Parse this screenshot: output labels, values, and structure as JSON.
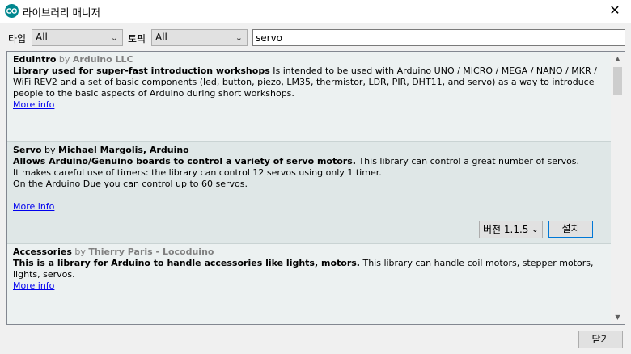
{
  "window": {
    "title": "라이브러리 매니저",
    "close_glyph": "✕"
  },
  "filters": {
    "type_label": "타입",
    "type_value": "All",
    "topic_label": "토픽",
    "topic_value": "All",
    "search_value": "servo"
  },
  "libraries": [
    {
      "name": "EduIntro",
      "by": "by",
      "author": "Arduino LLC",
      "sentence": "Library used for super-fast introduction workshops",
      "paragraph": "Is intended to be used with Arduino UNO / MICRO / MEGA / NANO / MKR / WiFi REV2 and a set of basic components (led, button, piezo, LM35, thermistor, LDR, PIR, DHT11, and servo) as a way to introduce people to the basic aspects of Arduino during short workshops.",
      "more_info": "More info"
    },
    {
      "name": "Servo",
      "by": "by",
      "author": "Michael Margolis, Arduino",
      "sentence": "Allows Arduino/Genuino boards to control a variety of servo motors.",
      "paragraph_1": "This library can control a great number of servos.",
      "paragraph_2": "It makes careful use of timers: the library can control 12 servos using only 1 timer.",
      "paragraph_3": "On the Arduino Due you can control up to 60 servos.",
      "more_info": "More info",
      "version_select": "버전 1.1.5",
      "install_label": "설치"
    },
    {
      "name": "Accessories",
      "by": "by",
      "author": "Thierry Paris - Locoduino",
      "sentence": "This is a library for Arduino to handle accessories like lights, motors.",
      "paragraph": "This library can handle coil motors, stepper motors, lights, servos.",
      "more_info": "More info"
    }
  ],
  "footer": {
    "close_label": "닫기"
  },
  "colors": {
    "accent_blue": "#0078d7",
    "link": "#0000ee",
    "arduino_teal": "#00878f"
  }
}
